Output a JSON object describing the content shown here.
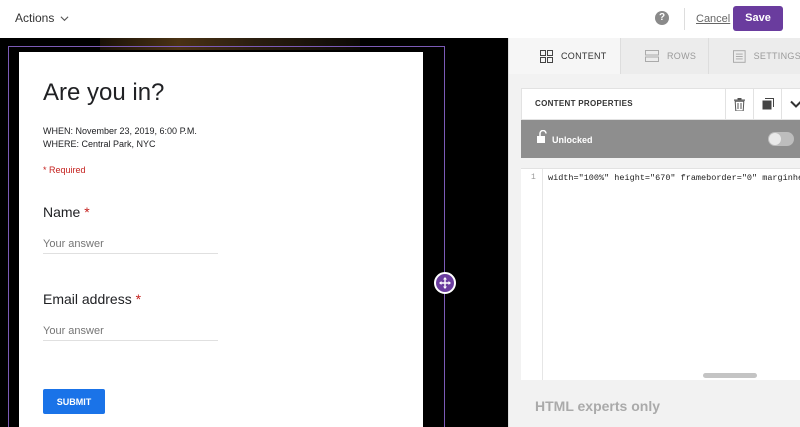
{
  "topbar": {
    "actions_label": "Actions",
    "help_glyph": "?",
    "cancel_label": "Cancel",
    "save_label": "Save",
    "accent_color": "#6a3c9e"
  },
  "form": {
    "title": "Are you in?",
    "when": "WHEN: November 23, 2019, 6:00 P.M.",
    "where": "WHERE: Central Park, NYC",
    "required_note": "* Required",
    "questions": [
      {
        "label": "Name",
        "required_mark": "*",
        "placeholder": "Your answer"
      },
      {
        "label": "Email address",
        "required_mark": "*",
        "placeholder": "Your answer"
      }
    ],
    "submit_label": "SUBMIT",
    "submit_color": "#1a73e8"
  },
  "panel": {
    "tabs": [
      {
        "label": "CONTENT",
        "icon": "grid-icon",
        "active": true
      },
      {
        "label": "ROWS",
        "icon": "rows-icon",
        "active": false
      },
      {
        "label": "SETTINGS",
        "icon": "settings-list-icon",
        "active": false
      }
    ],
    "properties_title": "CONTENT PROPERTIES",
    "lock_label": "Unlocked",
    "code_line_number": "1",
    "code_text": "width=\"100%\" height=\"670\" frameborder=\"0\" marginhe",
    "footer_text": "HTML experts only"
  }
}
